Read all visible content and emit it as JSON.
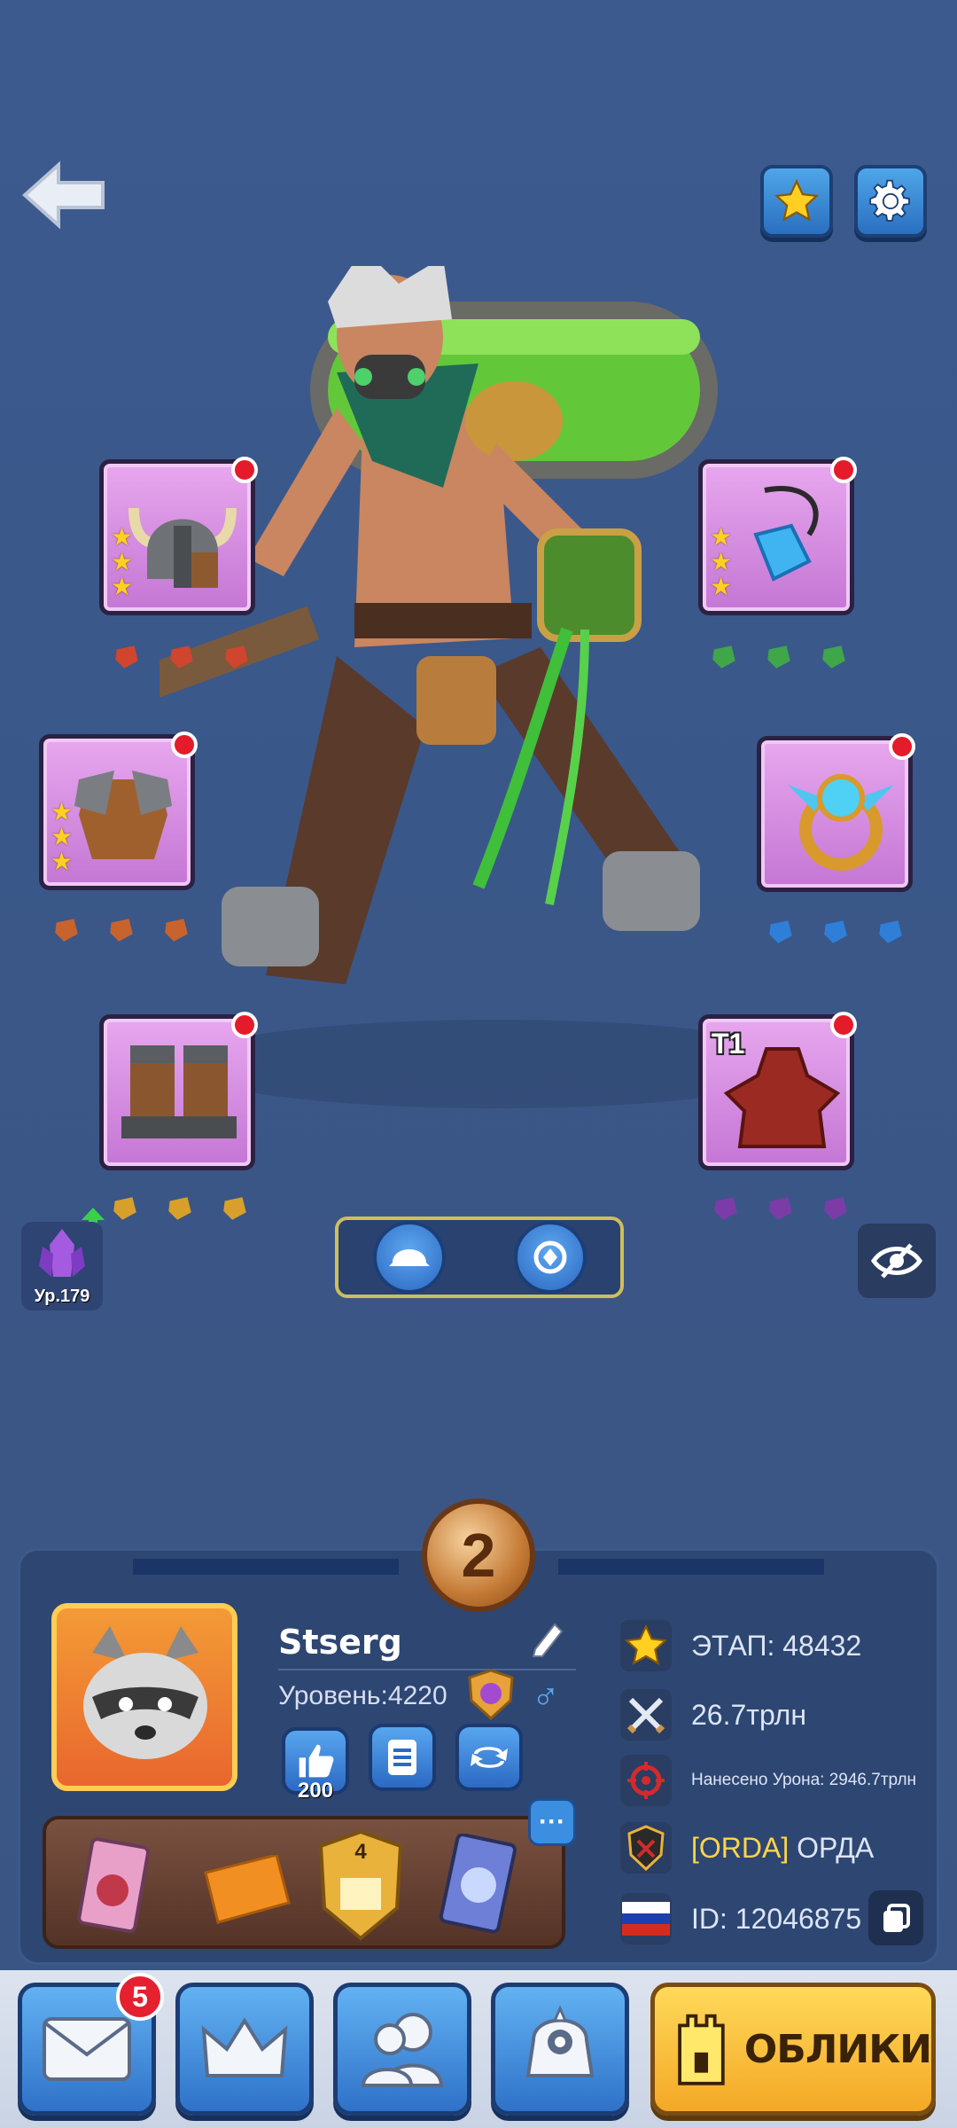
{
  "hero_equipment": {
    "tier_label": "T1",
    "left_slots": [
      {
        "name": "helmet",
        "stars": 3
      },
      {
        "name": "armor",
        "stars": 3
      },
      {
        "name": "boots",
        "stars": 0
      }
    ],
    "right_slots": [
      {
        "name": "amulet",
        "stars": 3
      },
      {
        "name": "ring",
        "stars": 0
      },
      {
        "name": "cape",
        "stars": 0
      }
    ]
  },
  "crystal": {
    "level_label": "Ур.179"
  },
  "player": {
    "rank": "2",
    "name": "Stserg",
    "level_label": "Уровень:4220",
    "gender_symbol": "♂",
    "likes": "200"
  },
  "collection": {
    "more_label": "···"
  },
  "stats": {
    "stage": "ЭТАП: 48432",
    "power": "26.7трлн",
    "damage": "Нанесено Урона: 2946.7трлн",
    "guild_tag": "[ORDA]",
    "guild_name": "ОРДА",
    "id": "ID: 12046875"
  },
  "nav": {
    "mail_badge": "5",
    "skins_label": "ОБЛИКИ"
  },
  "colors": {
    "accent": "#2f72c9",
    "badge": "#e5202f",
    "slot_bg": "#d48be0",
    "gold": "#ffd021"
  }
}
